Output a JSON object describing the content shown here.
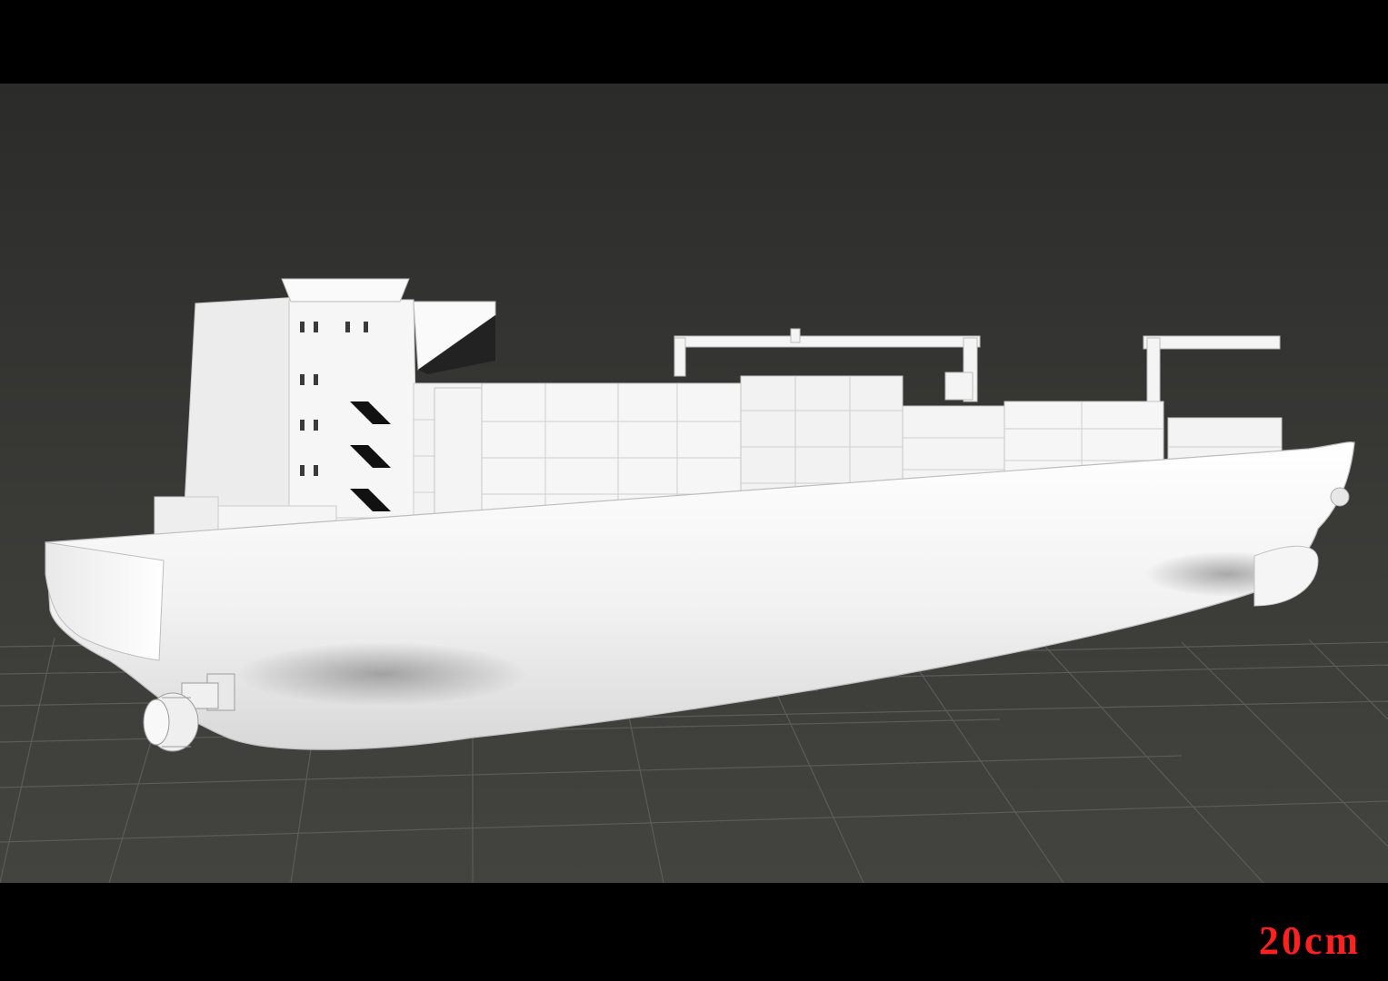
{
  "viewport": {
    "background": "#3a3a37",
    "grid_color": "#5a5a55",
    "model_color": "#f2f2f2",
    "model": "container-ship"
  },
  "scale_label": {
    "text": "20cm",
    "color": "#ff2020"
  }
}
